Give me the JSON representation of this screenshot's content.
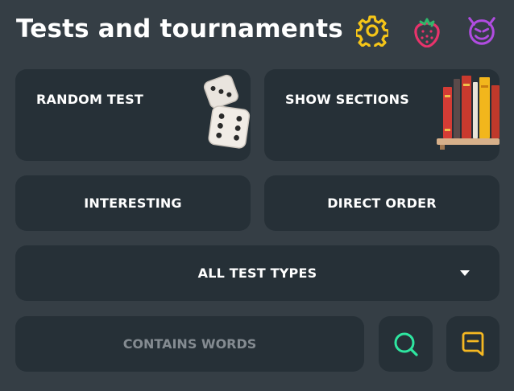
{
  "header": {
    "title": "Tests and tournaments",
    "icons": [
      "gear-icon",
      "strawberry-icon",
      "devil-icon"
    ],
    "colors": {
      "gear": "#f5c518",
      "strawberry": "#e8336b",
      "devil": "#b04ce0"
    }
  },
  "cards": {
    "random_test": "RANDOM TEST",
    "show_sections": "SHOW SECTIONS",
    "interesting": "INTERESTING",
    "direct_order": "DIRECT ORDER",
    "all_test_types": "ALL TEST TYPES"
  },
  "search": {
    "placeholder": "CONTAINS WORDS",
    "search_icon": "search-icon",
    "bookmark_icon": "bookmark-icon",
    "colors": {
      "search": "#2ee6a0",
      "bookmark": "#f5b822"
    }
  },
  "theme": {
    "background": "#353e45",
    "card": "#263037"
  }
}
